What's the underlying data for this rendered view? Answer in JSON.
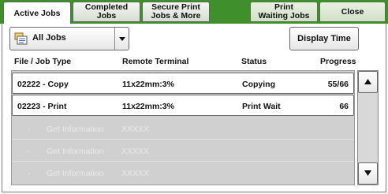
{
  "tabs": [
    {
      "label": "Active Jobs",
      "active": true
    },
    {
      "label": "Completed\nJobs",
      "active": false
    },
    {
      "label": "Secure Print\nJobs & More",
      "active": false
    },
    {
      "label": "Print\nWaiting Jobs",
      "active": false
    },
    {
      "label": "Close",
      "active": false
    }
  ],
  "filter": {
    "selected": "All Jobs"
  },
  "display_time_label": "Display Time",
  "columns": {
    "file": "File / Job Type",
    "remote": "Remote Terminal",
    "status": "Status",
    "progress": "Progress"
  },
  "jobs": [
    {
      "file": "02222 - Copy",
      "remote": "11x22mm:3%",
      "status": "Copying",
      "progress": "55/66"
    },
    {
      "file": "02223 - Print",
      "remote": "11x22mm:3%",
      "status": "Print Wait",
      "progress": "66"
    }
  ],
  "placeholder_rows": [
    {
      "prefix": "-",
      "file": "Get Information",
      "remote": "XXXXX"
    },
    {
      "prefix": "-",
      "file": "Get Information",
      "remote": "XXXXX"
    },
    {
      "prefix": "-",
      "file": "Get Information",
      "remote": "XXXXX"
    }
  ],
  "colors": {
    "tabbar_green": "#3f8f2c"
  },
  "icons": {
    "filter": "jobs-list-icon",
    "dropdown": "chevron-down-icon",
    "scroll_up": "arrow-up-icon",
    "scroll_down": "arrow-down-icon"
  }
}
